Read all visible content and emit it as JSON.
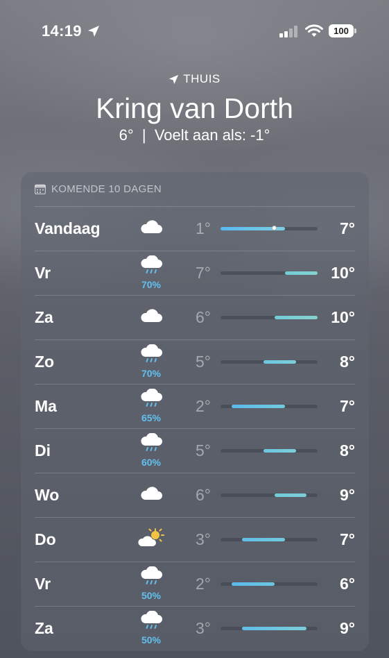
{
  "status": {
    "time": "14:19",
    "battery": "100"
  },
  "header": {
    "location_label": "THUIS",
    "city": "Kring van Dorth",
    "current_temp": "6°",
    "separator": "|",
    "feels_like": "Voelt aan als: -1°"
  },
  "forecast": {
    "title": "KOMENDE 10 DAGEN",
    "range_min": 1,
    "range_max": 10,
    "days": [
      {
        "day": "Vandaag",
        "icon": "cloud-icon",
        "precip": "",
        "low": "1°",
        "high": "7°",
        "low_val": 1,
        "high_val": 7,
        "current_val": 6,
        "color_start": "#5ab8f2",
        "color_end": "#7ccfe0"
      },
      {
        "day": "Vr",
        "icon": "cloud-rain-icon",
        "precip": "70%",
        "low": "7°",
        "high": "10°",
        "low_val": 7,
        "high_val": 10,
        "color_start": "#72cbd8",
        "color_end": "#86d3d0"
      },
      {
        "day": "Za",
        "icon": "cloud-icon",
        "precip": "",
        "low": "6°",
        "high": "10°",
        "low_val": 6,
        "high_val": 10,
        "color_start": "#72cbd8",
        "color_end": "#86d3d0"
      },
      {
        "day": "Zo",
        "icon": "cloud-rain-icon",
        "precip": "70%",
        "low": "5°",
        "high": "8°",
        "low_val": 5,
        "high_val": 8,
        "color_start": "#6cc6e0",
        "color_end": "#7ccfd8"
      },
      {
        "day": "Ma",
        "icon": "cloud-rain-icon",
        "precip": "65%",
        "low": "2°",
        "high": "7°",
        "low_val": 2,
        "high_val": 7,
        "color_start": "#5cb8ee",
        "color_end": "#72cbdc"
      },
      {
        "day": "Di",
        "icon": "cloud-rain-icon",
        "precip": "60%",
        "low": "5°",
        "high": "8°",
        "low_val": 5,
        "high_val": 8,
        "color_start": "#6cc6e0",
        "color_end": "#7ccfd8"
      },
      {
        "day": "Wo",
        "icon": "cloud-icon",
        "precip": "",
        "low": "6°",
        "high": "9°",
        "low_val": 6,
        "high_val": 9,
        "color_start": "#72cbd8",
        "color_end": "#7ccfd8"
      },
      {
        "day": "Do",
        "icon": "partly-sunny-icon",
        "precip": "",
        "low": "3°",
        "high": "7°",
        "low_val": 3,
        "high_val": 7,
        "color_start": "#62bce8",
        "color_end": "#72cbdc"
      },
      {
        "day": "Vr",
        "icon": "cloud-rain-icon",
        "precip": "50%",
        "low": "2°",
        "high": "6°",
        "low_val": 2,
        "high_val": 6,
        "color_start": "#5cb8ee",
        "color_end": "#6cc6e0"
      },
      {
        "day": "Za",
        "icon": "cloud-rain-icon",
        "precip": "50%",
        "low": "3°",
        "high": "9°",
        "low_val": 3,
        "high_val": 9,
        "color_start": "#62bce8",
        "color_end": "#7ccfd8"
      }
    ]
  }
}
